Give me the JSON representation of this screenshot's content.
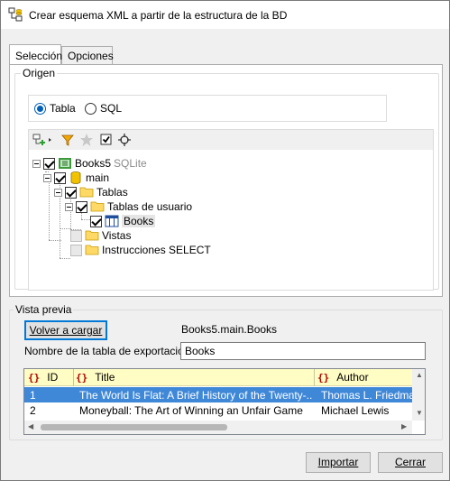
{
  "window": {
    "title": "Crear esquema XML a partir de la estructura de la BD",
    "icon": "xml-schema-db-icon"
  },
  "tabs": [
    {
      "label": "Selección",
      "active": true
    },
    {
      "label": "Opciones",
      "active": false
    }
  ],
  "origin": {
    "legend": "Origen",
    "radio_tabla": "Tabla",
    "radio_sql": "SQL",
    "selected": "Tabla"
  },
  "tree": {
    "toolbar_icons": [
      "add-node-icon",
      "chevron-right-icon",
      "filter-icon",
      "favorite-star-icon",
      "check-icon",
      "locate-icon"
    ],
    "database": "Books5",
    "database_type": "SQLite",
    "schema": "main",
    "tables_folder": "Tablas",
    "user_tables_folder": "Tablas de usuario",
    "table": "Books",
    "views_folder": "Vistas",
    "select_folder": "Instrucciones SELECT"
  },
  "preview": {
    "legend": "Vista previa",
    "reload_button": "Volver a cargar",
    "path": "Books5.main.Books",
    "export_name_label": "Nombre de la tabla de exportación:",
    "export_name_value": "Books",
    "columns": [
      "ID",
      "Title",
      "Author"
    ],
    "rows": [
      [
        "1",
        "The World Is Flat: A Brief History of the Twenty-...",
        "Thomas L. Friedman"
      ],
      [
        "2",
        "Moneyball: The Art of Winning an Unfair Game",
        "Michael Lewis"
      ]
    ]
  },
  "footer": {
    "import_button": "Importar",
    "close_button": "Cerrar"
  },
  "colors": {
    "selected_row": "#3f88d8",
    "grid_header": "#fffcc4",
    "radio_accent": "#005fb8"
  }
}
